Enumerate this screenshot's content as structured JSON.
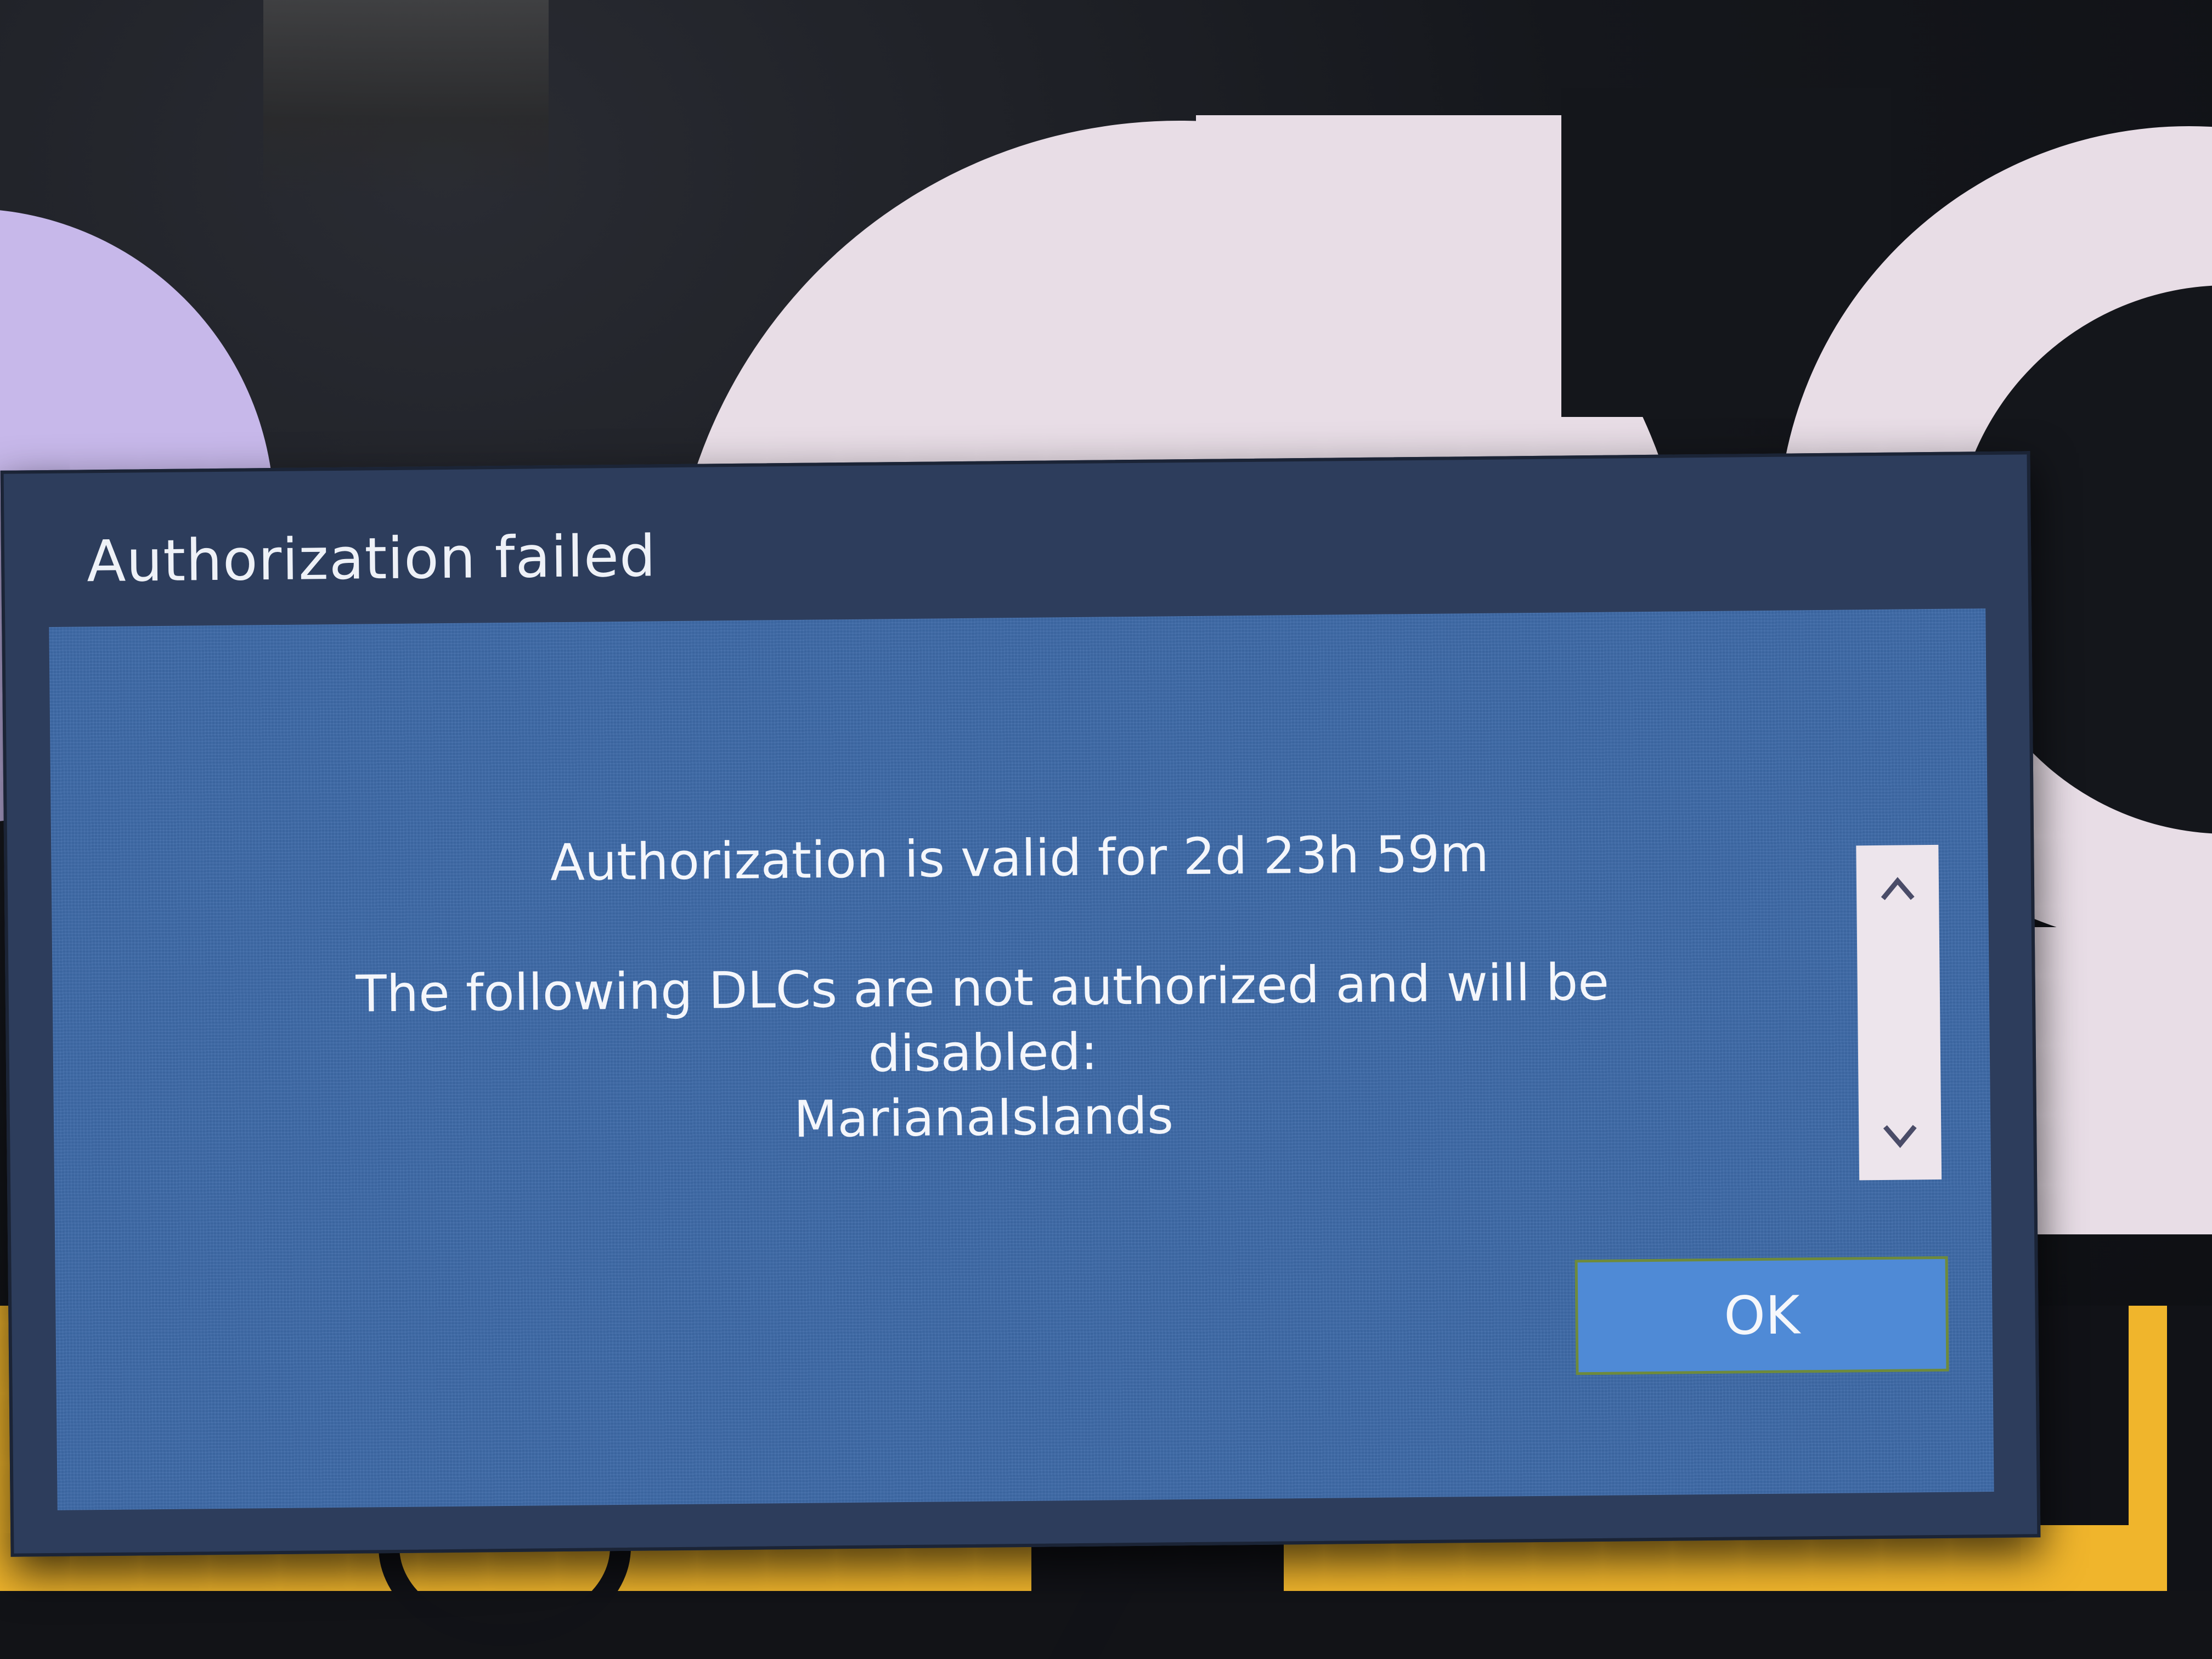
{
  "dialog": {
    "title": "Authorization failed",
    "message": {
      "validity": "Authorization is valid for 2d 23h 59m",
      "dlc_intro": "The following DLCs are not authorized and will be disabled:",
      "dlc_name": "MarianaIslands"
    },
    "ok_label": "OK"
  },
  "icons": {
    "scroll_up": "chevron-up-icon",
    "scroll_down": "chevron-down-icon"
  },
  "colors": {
    "dialog_frame": "#2d3d5c",
    "dialog_body": "#3e6aa8",
    "ok_button": "#4f8ad6",
    "ok_button_focus_border": "#6e8a3c",
    "scrollbar": "#ede5ec",
    "background_yellow": "#f0b52c",
    "background_pink": "#e8dde6",
    "background_lavender": "#c7b8ea"
  }
}
